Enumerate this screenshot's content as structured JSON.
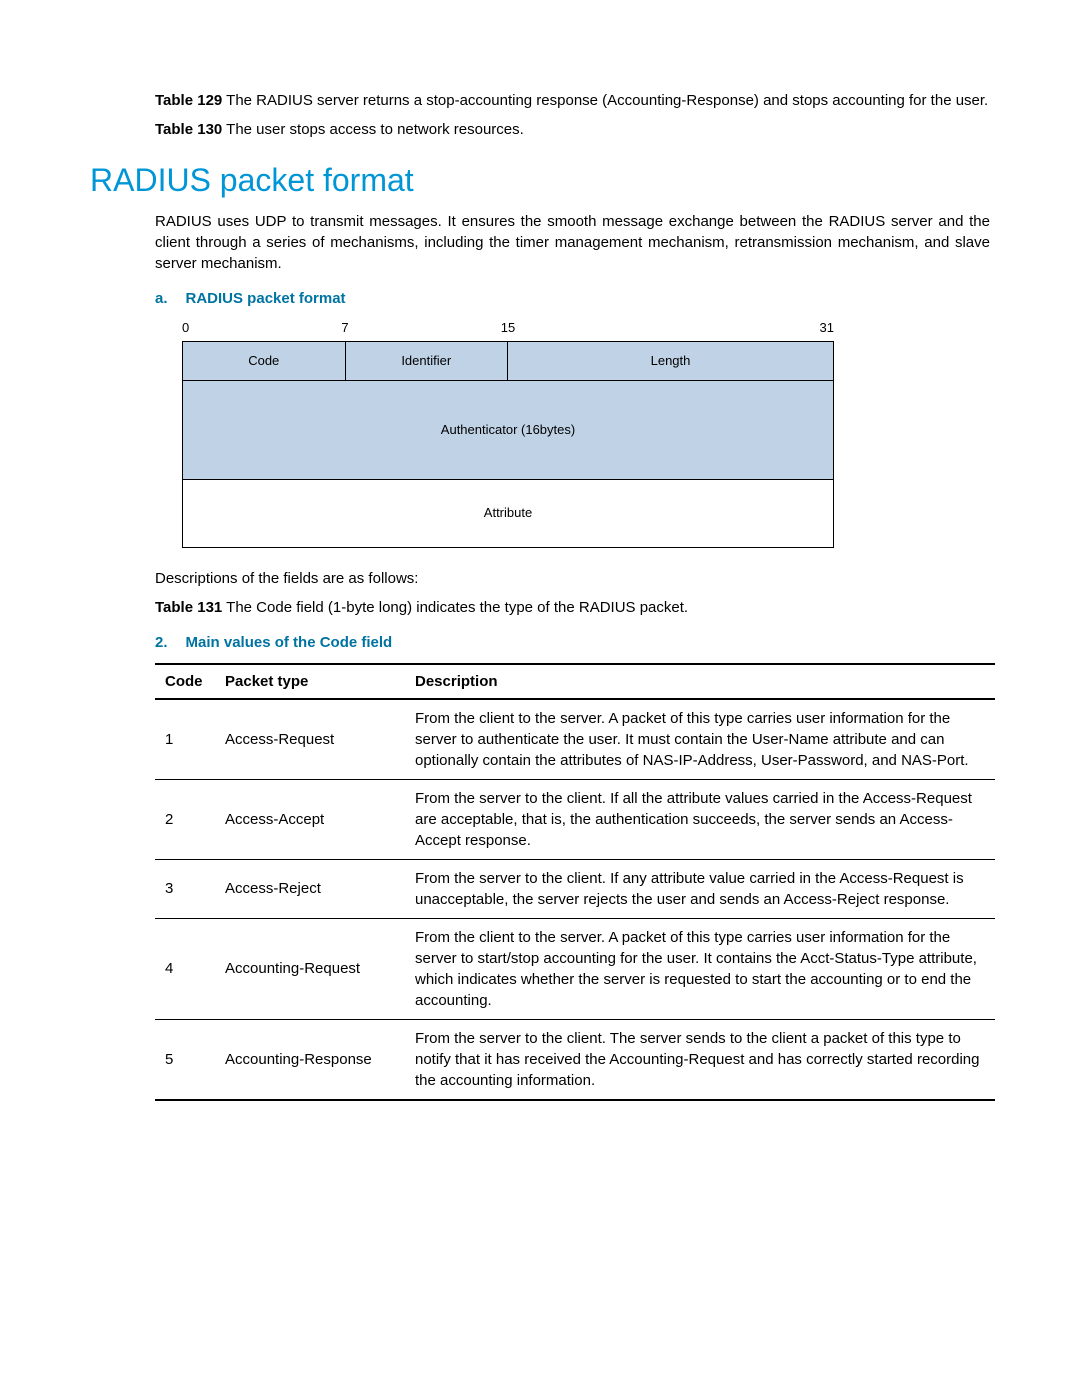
{
  "preamble": {
    "item129": {
      "label": "Table 129",
      "text": " The RADIUS server returns a stop-accounting response (Accounting-Response) and stops accounting for the user."
    },
    "item130": {
      "label": "Table 130",
      "text": " The user stops access to network resources."
    }
  },
  "heading": "RADIUS packet format",
  "intro": "RADIUS uses UDP to transmit messages. It ensures the smooth message exchange between the RADIUS server and the client through a series of mechanisms, including the timer management mechanism, retransmission mechanism, and slave server mechanism.",
  "subheading_a": {
    "marker": "a.",
    "text": "RADIUS packet format"
  },
  "packet": {
    "bits": {
      "b0": "0",
      "b7": "7",
      "b15": "15",
      "b31": "31"
    },
    "code": "Code",
    "identifier": "Identifier",
    "length": "Length",
    "authenticator": "Authenticator (16bytes)",
    "attribute": "Attribute"
  },
  "desc_intro": "Descriptions of the fields are as follows:",
  "item131": {
    "label": "Table 131",
    "text": " The Code field (1-byte long) indicates the type of the RADIUS packet."
  },
  "subheading_2": {
    "marker": "2.",
    "text": "Main values of the Code field"
  },
  "table": {
    "headers": {
      "code": "Code",
      "type": "Packet type",
      "desc": "Description"
    },
    "rows": [
      {
        "code": "1",
        "type": "Access-Request",
        "desc": "From the client to the server. A packet of this type carries user information for the server to authenticate the user. It must contain the User-Name attribute and can optionally contain the attributes of NAS-IP-Address, User-Password, and NAS-Port."
      },
      {
        "code": "2",
        "type": "Access-Accept",
        "desc": "From the server to the client. If all the attribute values carried in the Access-Request are acceptable, that is, the authentication succeeds, the server sends an Access-Accept response."
      },
      {
        "code": "3",
        "type": "Access-Reject",
        "desc": "From the server to the client. If any attribute value carried in the Access-Request is unacceptable, the server rejects the user and sends an Access-Reject response."
      },
      {
        "code": "4",
        "type": "Accounting-Request",
        "desc": "From the client to the server. A packet of this type carries user information for the server to start/stop accounting for the user. It contains the Acct-Status-Type attribute, which indicates whether the server is requested to start the accounting or to end the accounting."
      },
      {
        "code": "5",
        "type": "Accounting-Response",
        "desc": "From the server to the client. The server sends to the client a packet of this type to notify that it has received the Accounting-Request and has correctly started recording the accounting information."
      }
    ]
  }
}
